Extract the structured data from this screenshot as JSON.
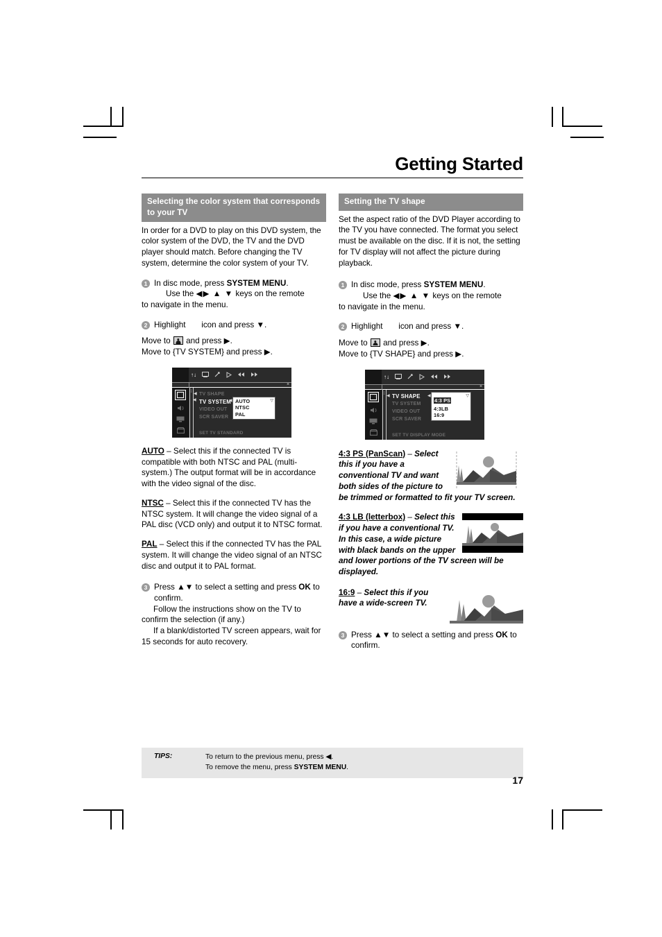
{
  "page": {
    "header_title": "Getting Started",
    "page_number": "17"
  },
  "left_column": {
    "section_heading": "Selecting the color system that corresponds to your TV",
    "intro": "In order for a DVD to play on this DVD system, the color system of the DVD, the TV and the DVD player should match. Before changing the TV system, determine the color system of your TV.",
    "steps": [
      {
        "num": "1",
        "line1_pre": "In disc mode, press ",
        "line1_bold": "SYSTEM MENU",
        "line1_post": ".",
        "line2_pre": "Use the ",
        "line2_arrows": "◀▶ ▲ ▼",
        "line2_post": " keys on the remote",
        "line3": "to navigate in the menu."
      },
      {
        "num": "2",
        "line1_pre": "Highlight",
        "line1_post": "icon and press ▼.",
        "line2_pre": "Move to ",
        "line2_post": " and press ▶.",
        "line3": "Move to {TV SYSTEM} and press ▶."
      },
      {
        "num": "3",
        "line1_pre": "Press ▲▼ to select a setting and press ",
        "line1_bold": "OK",
        "line1_post": " to confirm.",
        "line2": "Follow the instructions show on the TV to confirm the selection (if any.)",
        "line3": "If a blank/distorted TV screen appears, wait for 15 seconds for auto recovery."
      }
    ],
    "osd": {
      "rows": [
        "TV SHAPE",
        "TV SYSTEM",
        "VIDEO OUT",
        "SCR SAVER"
      ],
      "active_row": "TV SYSTEM",
      "footer": "SET TV STANDARD",
      "popup_items": [
        "AUTO",
        "NTSC",
        "PAL"
      ],
      "popup_selected": "AUTO"
    },
    "options": [
      {
        "label": "AUTO",
        "dash": " – ",
        "desc": "Select this if the connected TV is compatible with both NTSC and PAL (multi-system.)  The output format will be in accordance with the video signal of the disc."
      },
      {
        "label": "NTSC",
        "dash": " – ",
        "desc": "Select this if the connected TV has the NTSC system. It will change the video signal of a PAL disc (VCD only) and output it to NTSC format."
      },
      {
        "label": "PAL",
        "dash": " – ",
        "desc": "Select this if the connected TV has the PAL system. It will change the video signal of an NTSC disc and output it to PAL format."
      }
    ]
  },
  "right_column": {
    "section_heading": "Setting the TV shape",
    "intro": "Set the aspect ratio of the DVD Player according to the TV you have connected. The format you select must be available on the disc.  If it is not, the setting for TV display will not affect the picture during playback.",
    "steps": [
      {
        "num": "1",
        "line1_pre": "In disc mode, press ",
        "line1_bold": "SYSTEM MENU",
        "line1_post": ".",
        "line2_pre": "Use the ",
        "line2_arrows": "◀▶ ▲ ▼",
        "line2_post": " keys on the remote",
        "line3": "to navigate in the menu."
      },
      {
        "num": "2",
        "line1_pre": "Highlight",
        "line1_post": "icon and press ▼.",
        "line2_pre": "Move to ",
        "line2_post": " and press ▶.",
        "line3": "Move to {TV SHAPE} and press ▶."
      },
      {
        "num": "3",
        "line1_pre": "Press ▲▼ to select a setting and press ",
        "line1_bold": "OK",
        "line1_post": " to confirm."
      }
    ],
    "osd": {
      "rows": [
        "TV SHAPE",
        "TV SYSTEM",
        "VIDEO OUT",
        "SCR SAVER"
      ],
      "active_row": "TV SHAPE",
      "footer": "SET TV DISPLAY MODE",
      "popup_items": [
        "4:3 PS",
        "4:3LB",
        "16:9"
      ],
      "popup_selected": "4:3 PS"
    },
    "options": [
      {
        "label": "4:3 PS (PanScan)",
        "dash": " – ",
        "desc": "Select this if you have a conventional TV and want both sides of the picture to be trimmed or formatted to fit your TV screen.",
        "thumb": "panscan"
      },
      {
        "label": "4:3 LB (letterbox)",
        "dash": " – ",
        "desc": "Select this if you have a conventional TV. In this case, a wide picture with black bands on the upper and lower portions of the TV screen will be displayed.",
        "thumb": "letterbox"
      },
      {
        "label": "16:9",
        "dash": " – ",
        "desc": "Select this if you have a wide-screen TV.",
        "thumb": "widescreen"
      }
    ]
  },
  "tips": {
    "label": "TIPS:",
    "line1_pre": "To return to the previous menu, press ",
    "line1_arrow": "◀",
    "line1_post": ".",
    "line2_pre": "To remove the menu, press ",
    "line2_bold": "SYSTEM MENU",
    "line2_post": "."
  }
}
